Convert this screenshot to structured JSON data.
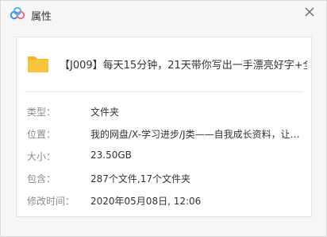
{
  "window": {
    "title": "属性"
  },
  "file": {
    "name": "【J009】每天15分钟，21天带你写出一手漂亮好字+全…"
  },
  "properties": [
    {
      "label": "类型：",
      "value": "文件夹"
    },
    {
      "label": "位置：",
      "value": "我的网盘/X-学习进步/J类——自我成长资料，让…"
    },
    {
      "label": "大小：",
      "value": "23.50GB"
    },
    {
      "label": "包含：",
      "value": "287个文件,17个文件夹"
    },
    {
      "label": "修改时间：",
      "value": "2020年05月08日, 12:06"
    }
  ],
  "icons": {
    "app": "baidu-netdisk-cloud-icon",
    "close": "close-icon",
    "folder": "folder-icon"
  },
  "colors": {
    "folder": "#f8c43a",
    "app_blue": "#3a8ee6",
    "app_pink": "#ef6b8c"
  }
}
